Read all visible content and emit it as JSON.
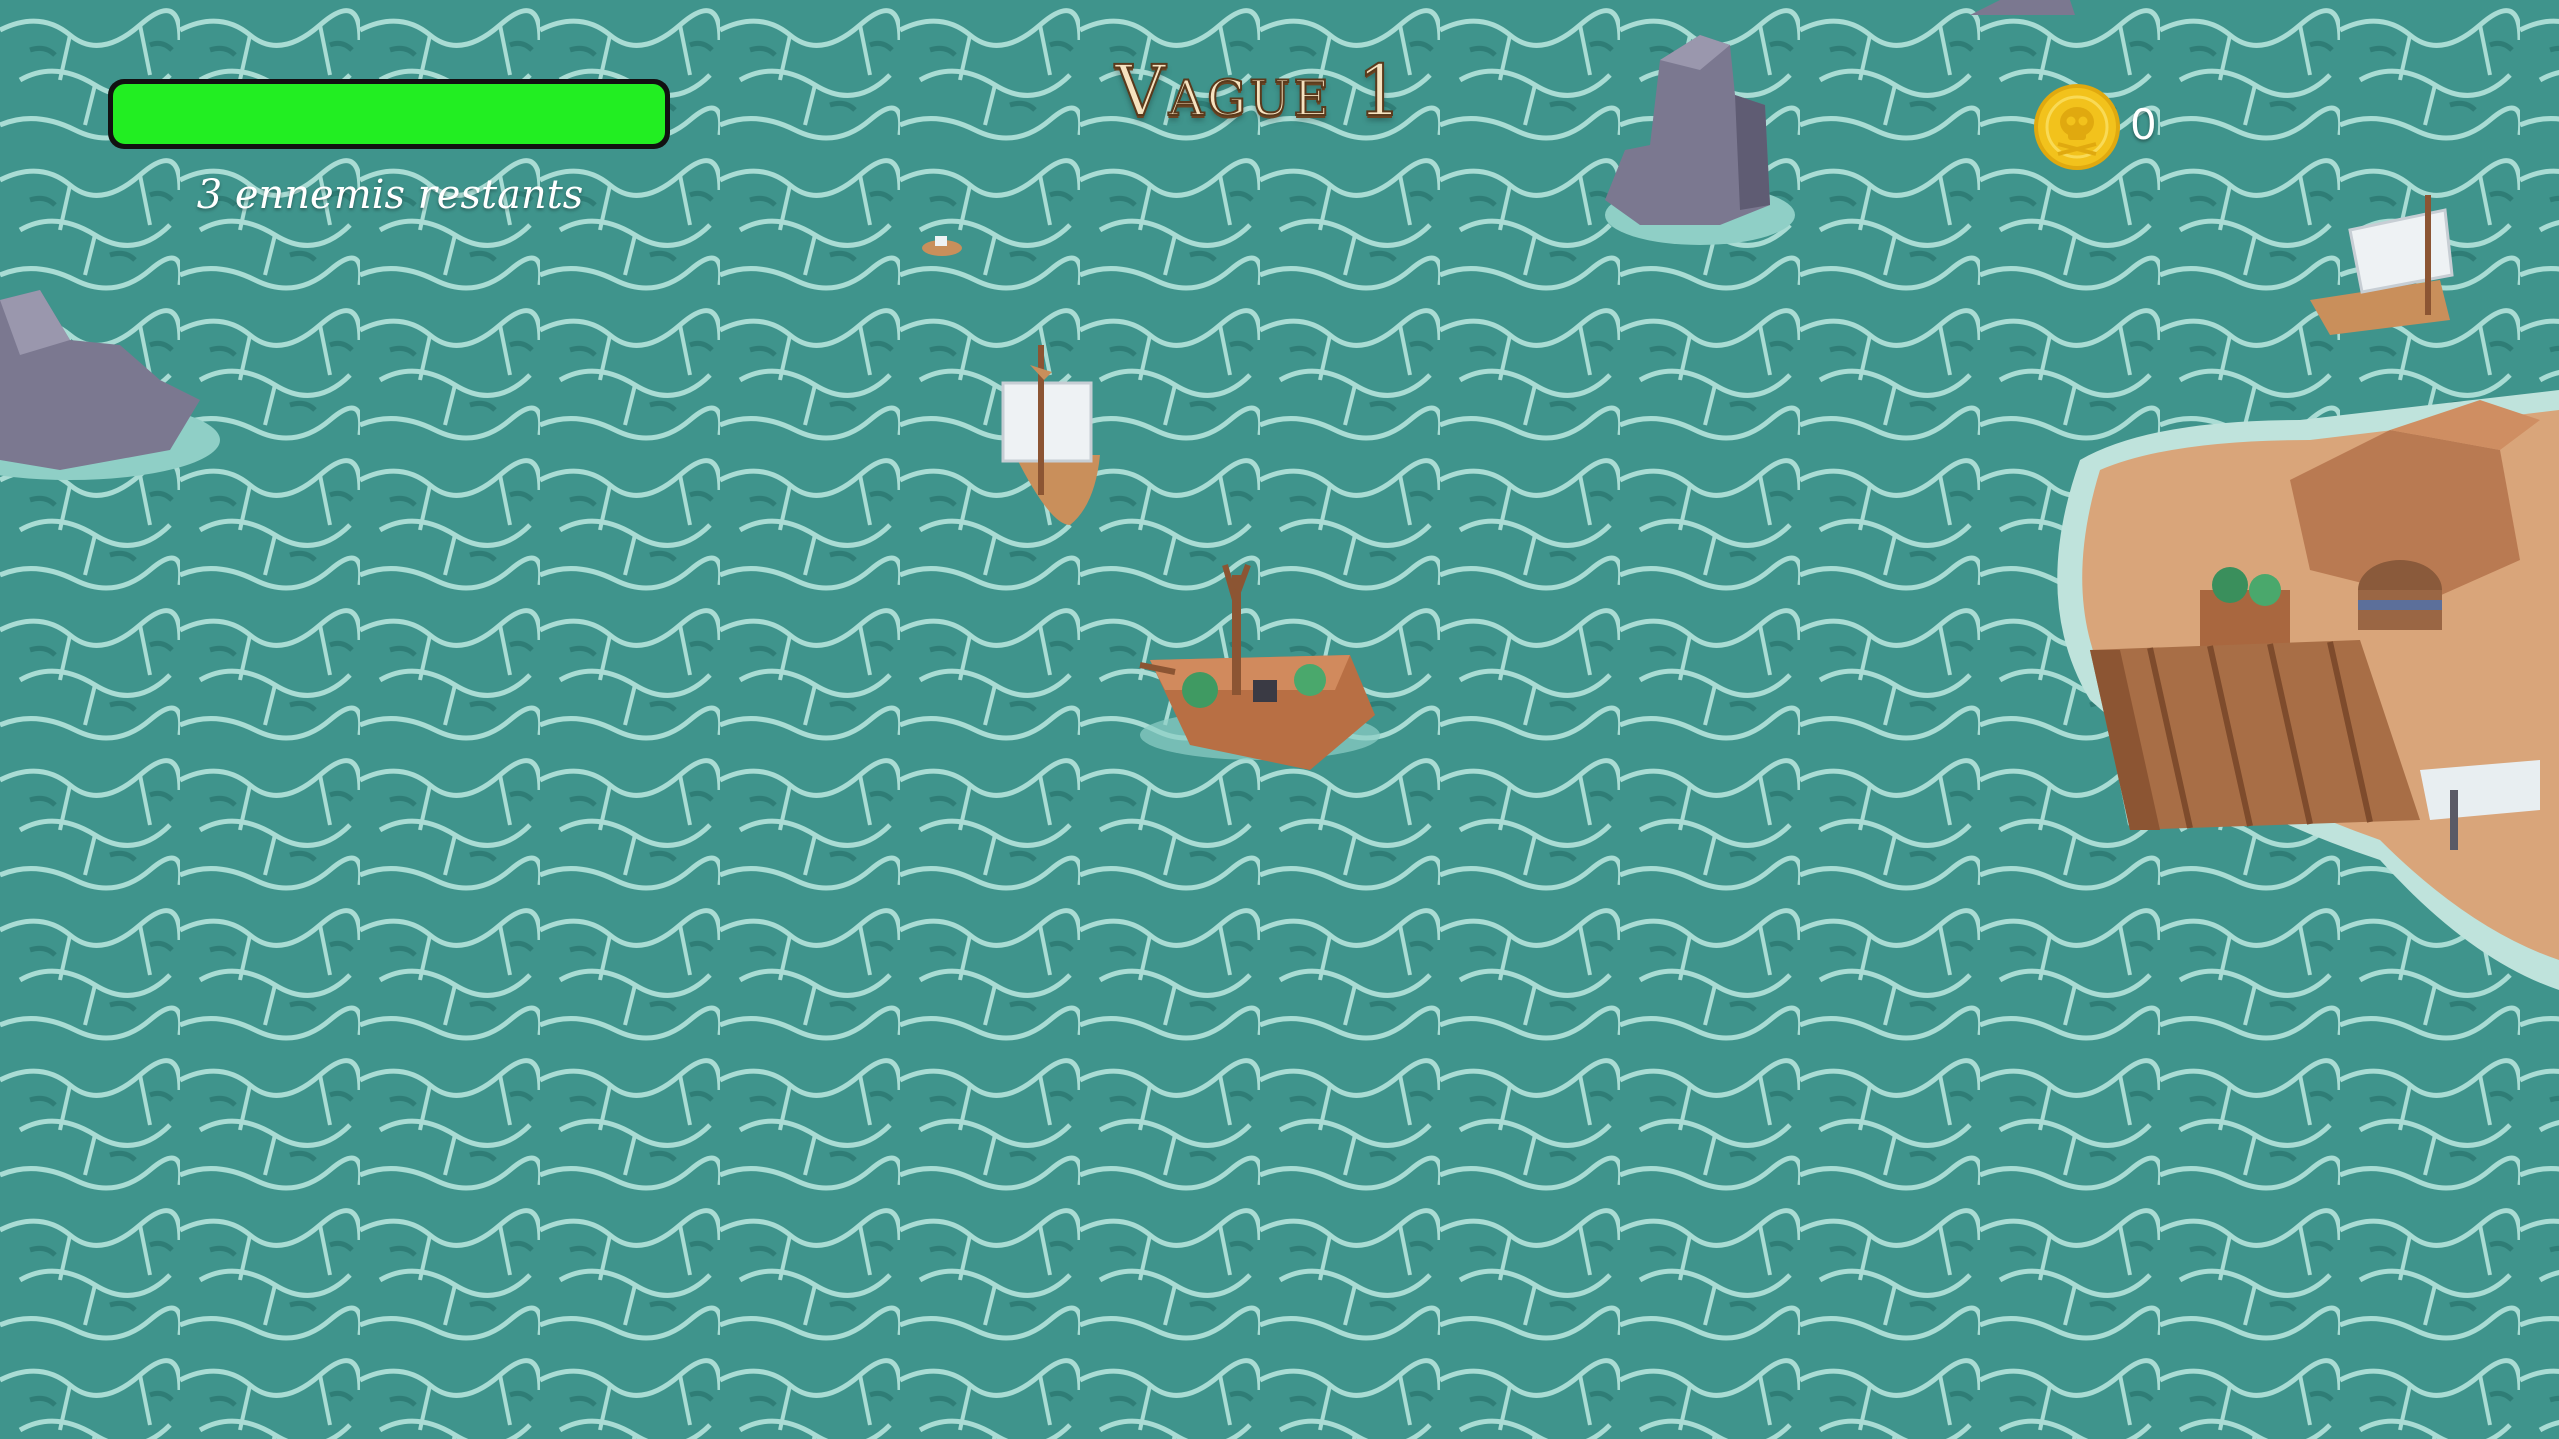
{
  "hud": {
    "health": {
      "fraction": 1.0,
      "fill_color": "#22ee22"
    },
    "enemies_remaining_text": "3 ennemis restants",
    "wave_title": "Vague 1",
    "coins": {
      "icon": "skull-coin-icon",
      "count": "0"
    }
  },
  "scene": {
    "water_color": "#3f948c",
    "entities": [
      {
        "name": "player-ship"
      },
      {
        "name": "enemy-ship"
      },
      {
        "name": "enemy-ship"
      },
      {
        "name": "enemy-ship"
      },
      {
        "name": "rock"
      },
      {
        "name": "rock"
      },
      {
        "name": "island-with-dock"
      }
    ]
  }
}
